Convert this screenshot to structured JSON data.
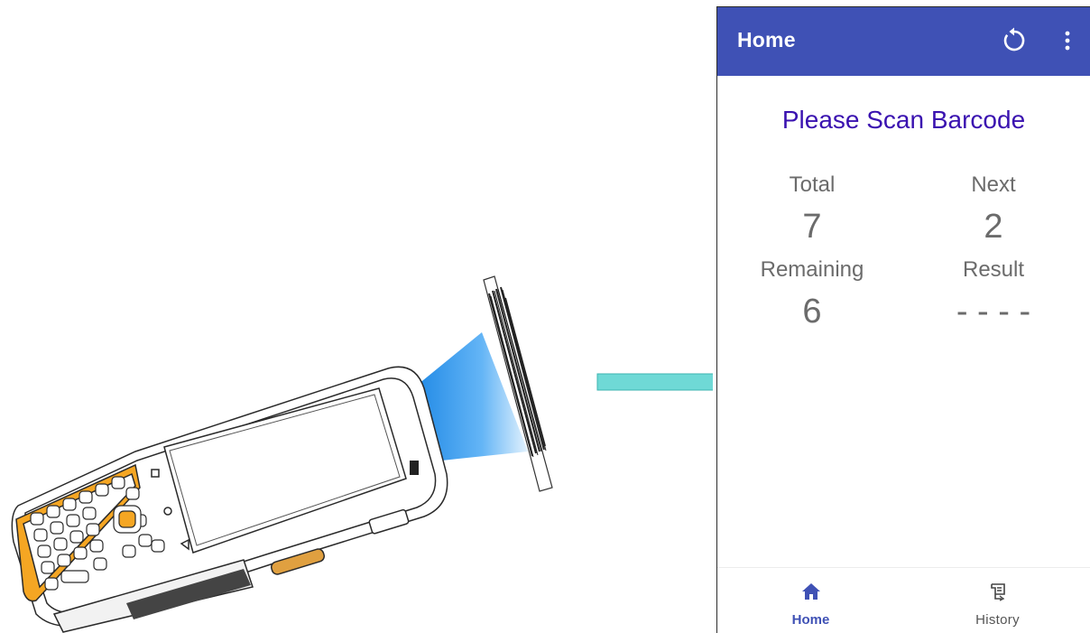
{
  "appbar": {
    "title": "Home",
    "refresh_icon": "refresh-icon",
    "more_icon": "more-vert-icon",
    "background": "#3f51b5"
  },
  "main": {
    "prompt": "Please Scan Barcode",
    "stats": {
      "total_label": "Total",
      "total_value": "7",
      "next_label": "Next",
      "next_value": "2",
      "remaining_label": "Remaining",
      "remaining_value": "6",
      "result_label": "Result",
      "result_value": "- - - -"
    }
  },
  "bottom_nav": {
    "items": [
      {
        "label": "Home",
        "icon": "home-icon",
        "selected": true
      },
      {
        "label": "History",
        "icon": "history-icon",
        "selected": false
      }
    ]
  },
  "colors": {
    "accent": "#3f51b5",
    "prompt_text": "#3a12b0",
    "arrow": "#6fd9d6",
    "scan_beam": "#1e88e5",
    "device_keys": "#f5a623"
  }
}
